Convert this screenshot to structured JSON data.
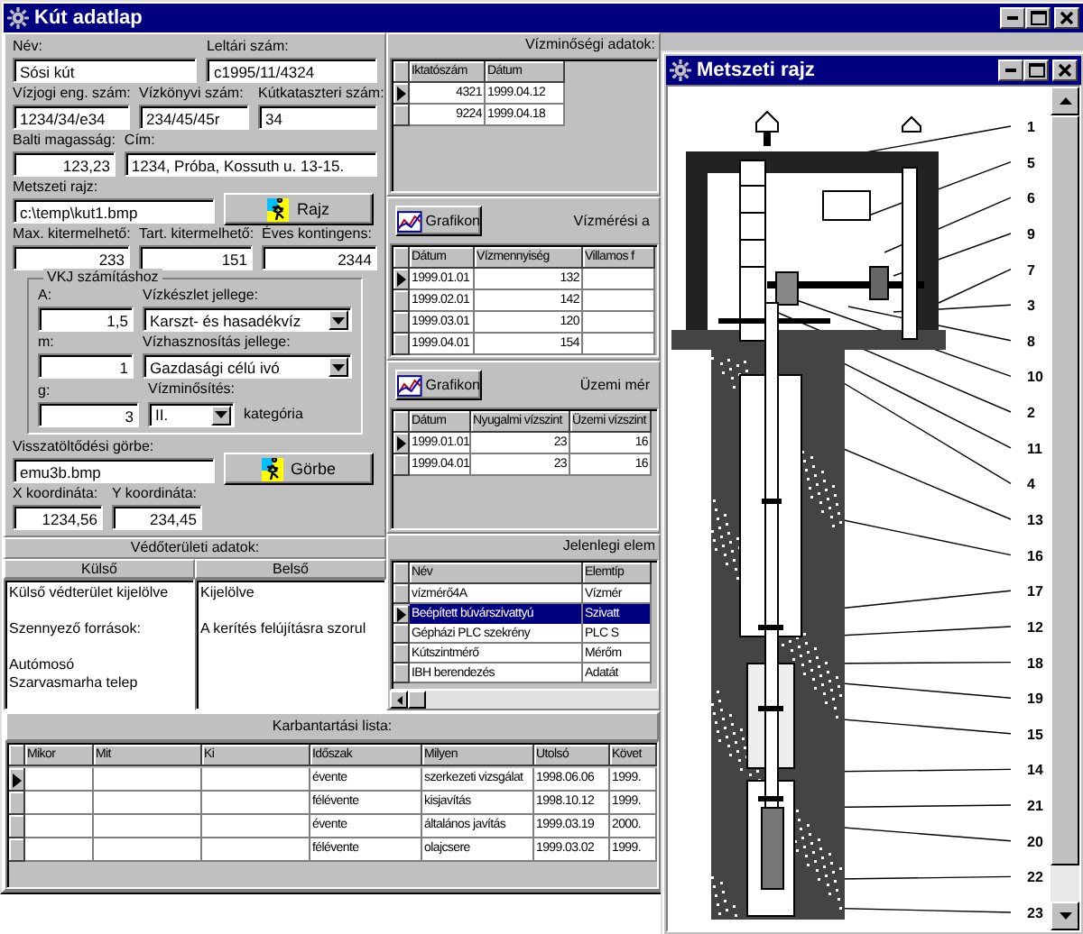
{
  "main_window": {
    "title": "Kút adatlap"
  },
  "general": {
    "rows": [
      [
        {
          "label": "Név:",
          "value": "Sósi kút",
          "kind": "text"
        },
        {
          "label": "Leltári szám:",
          "value": "c1995/11/4324",
          "kind": "text"
        }
      ],
      [
        {
          "label": "Vízjogi eng. szám:",
          "value": "1234/34/e34",
          "kind": "text"
        },
        {
          "label": "Vízkönyvi szám:",
          "value": "234/45/45r",
          "kind": "text"
        },
        {
          "label": "Kútkataszteri szám:",
          "value": "34",
          "kind": "text"
        }
      ],
      [
        {
          "label": "Balti magasság:",
          "value": "123,23",
          "kind": "number"
        },
        {
          "label": "Cím:",
          "value": "1234, Próba, Kossuth u. 13-15.",
          "kind": "text"
        }
      ]
    ]
  },
  "section_drawing": {
    "label": "Metszeti rajz:",
    "value": "c:\\temp\\kut1.bmp",
    "button": "Rajz"
  },
  "capacity": [
    {
      "label": "Max. kitermelhető:",
      "value": "233",
      "kind": "number"
    },
    {
      "label": "Tart. kitermelhető:",
      "value": "151",
      "kind": "number"
    },
    {
      "label": "Éves kontingens:",
      "value": "2344",
      "kind": "number"
    }
  ],
  "vkj_group": {
    "title": "VKJ számításhoz",
    "params": [
      {
        "label": "A:",
        "value": "1,5"
      },
      {
        "label": "m:",
        "value": "1"
      },
      {
        "label": "g:",
        "value": "3"
      }
    ],
    "selects": [
      {
        "label": "Vízkészlet jellege:",
        "value": "Karszt- és hasadékvíz"
      },
      {
        "label": "Vízhasznosítás jellege:",
        "value": "Gazdasági célú ivó"
      },
      {
        "label": "Vízminősítés:",
        "value": "II.",
        "suffix": "kategória"
      }
    ]
  },
  "recharge_curve": {
    "label": "Visszatöltődési görbe:",
    "value": "emu3b.bmp",
    "button": "Görbe"
  },
  "coordinates": [
    {
      "label": "X koordináta:",
      "value": "1234,56",
      "kind": "number"
    },
    {
      "label": "Y koordináta:",
      "value": "234,45",
      "kind": "number"
    }
  ],
  "protection_area": {
    "title": "Védőterületi adatok:",
    "columns": [
      {
        "header": "Külső",
        "paragraphs": [
          "Külső védterület kijelölve",
          "Szennyező források:",
          "Autómosó\nSzarvasmarha telep"
        ]
      },
      {
        "header": "Belső",
        "paragraphs": [
          "Kijelölve",
          "A kerítés felújításra szorul"
        ]
      }
    ]
  },
  "water_quality": {
    "title": "Vízminőségi adatok:",
    "columns": [
      {
        "label": "Iktatószám",
        "kind": "number"
      },
      {
        "label": "Dátum",
        "kind": "text"
      }
    ],
    "rows": [
      {
        "current": true,
        "selected": false,
        "cells": [
          "4321",
          "1999.04.12"
        ]
      },
      {
        "current": false,
        "selected": false,
        "cells": [
          "9224",
          "1999.04.18"
        ]
      }
    ]
  },
  "water_measurement": {
    "button": "Grafikon",
    "title": "Vízmérési a",
    "columns": [
      {
        "label": "Dátum",
        "kind": "text"
      },
      {
        "label": "Vízmennyiség",
        "kind": "number"
      },
      {
        "label": "Villamos f",
        "kind": "text"
      }
    ],
    "rows": [
      {
        "current": true,
        "selected": false,
        "cells": [
          "1999.01.01",
          "132",
          null
        ]
      },
      {
        "current": false,
        "selected": false,
        "cells": [
          "1999.02.01",
          "142",
          null
        ]
      },
      {
        "current": false,
        "selected": false,
        "cells": [
          "1999.03.01",
          "120",
          null
        ]
      },
      {
        "current": false,
        "selected": false,
        "cells": [
          "1999.04.01",
          "154",
          null
        ]
      }
    ]
  },
  "operation_measurement": {
    "button": "Grafikon",
    "title": "Üzemi mér",
    "columns": [
      {
        "label": "Dátum",
        "kind": "text"
      },
      {
        "label": "Nyugalmi vízszint",
        "kind": "number"
      },
      {
        "label": "Üzemi vízszint",
        "kind": "number"
      }
    ],
    "rows": [
      {
        "current": true,
        "selected": false,
        "cells": [
          "1999.01.01",
          "23",
          "16"
        ]
      },
      {
        "current": false,
        "selected": false,
        "cells": [
          "1999.04.01",
          "23",
          "16"
        ]
      }
    ]
  },
  "current_elements": {
    "title": "Jelenlegi elem",
    "columns": [
      {
        "label": "Név"
      },
      {
        "label": "Elemtíp"
      }
    ],
    "rows": [
      {
        "current": false,
        "selected": false,
        "cells": [
          "vízmérő4A",
          "Vízmér"
        ]
      },
      {
        "current": true,
        "selected": true,
        "cells": [
          "Beépített búvárszivattyú",
          "Szivatt"
        ]
      },
      {
        "current": false,
        "selected": false,
        "cells": [
          "Gépházi PLC szekrény",
          "PLC S"
        ]
      },
      {
        "current": false,
        "selected": false,
        "cells": [
          "Kútszintmérő",
          "Mérőm"
        ]
      },
      {
        "current": false,
        "selected": false,
        "cells": [
          "IBH berendezés",
          "Adatát"
        ]
      }
    ]
  },
  "maintenance": {
    "title": "Karbantartási lista:",
    "columns": [
      {
        "label": "Mikor"
      },
      {
        "label": "Mit"
      },
      {
        "label": "Ki"
      },
      {
        "label": "Időszak"
      },
      {
        "label": "Milyen"
      },
      {
        "label": "Utolsó"
      },
      {
        "label": "Követ"
      }
    ],
    "rows": [
      {
        "current": true,
        "selected": false,
        "cells": [
          null,
          null,
          null,
          "évente",
          "szerkezeti vizsgálat",
          "1998.06.06",
          "1999."
        ]
      },
      {
        "current": false,
        "selected": false,
        "cells": [
          null,
          null,
          null,
          "félévente",
          "kisjavítás",
          "1998.10.12",
          "1999."
        ]
      },
      {
        "current": false,
        "selected": false,
        "cells": [
          null,
          null,
          null,
          "évente",
          "általános javítás",
          "1999.03.19",
          "2000."
        ]
      },
      {
        "current": false,
        "selected": false,
        "cells": [
          null,
          null,
          null,
          "félévente",
          "olajcsere",
          "1999.03.02",
          "1999."
        ]
      }
    ]
  },
  "drawing_window": {
    "title": "Metszeti rajz",
    "callouts": [
      "1",
      "5",
      "6",
      "9",
      "7",
      "3",
      "8",
      "10",
      "2",
      "11",
      "4",
      "13",
      "16",
      "17",
      "12",
      "18",
      "19",
      "15",
      "14",
      "21",
      "20",
      "22",
      "23"
    ]
  }
}
